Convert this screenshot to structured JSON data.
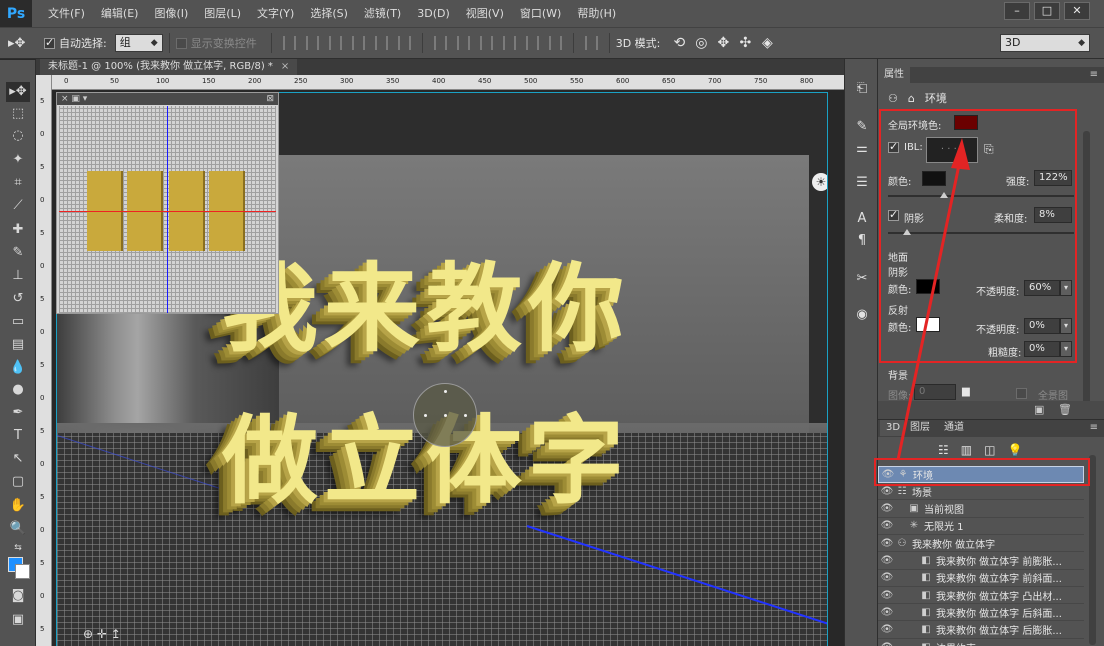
{
  "menubar": {
    "logo": "Ps",
    "items": [
      "文件(F)",
      "编辑(E)",
      "图像(I)",
      "图层(L)",
      "文字(Y)",
      "选择(S)",
      "滤镜(T)",
      "3D(D)",
      "视图(V)",
      "窗口(W)",
      "帮助(H)"
    ],
    "window_controls": [
      "–",
      "□",
      "✕"
    ]
  },
  "options": {
    "tool_icon": "move-icon",
    "auto_select_label": "自动选择:",
    "auto_select_value": "组",
    "show_transform_label": "显示变换控件",
    "mode3d_label": "3D 模式:",
    "workspace_value": "3D"
  },
  "document": {
    "tab_title": "未标题-1 @ 100% (我来教你 做立体字, RGB/8) *",
    "tab_close": "×",
    "ruler_h_ticks": [
      "0",
      "50",
      "100",
      "150",
      "200",
      "250",
      "300",
      "350",
      "400",
      "450",
      "500",
      "550",
      "600",
      "650",
      "700",
      "750",
      "800"
    ],
    "ruler_v_ticks": [
      "5",
      "0",
      "5",
      "0",
      "5",
      "0",
      "5",
      "0",
      "5",
      "0",
      "5",
      "0",
      "5",
      "0",
      "5",
      "0",
      "5"
    ],
    "text_line1": "我来教你",
    "text_line2": "做立体字",
    "thumb_close": "×"
  },
  "properties": {
    "tab": "属性",
    "panel_menu": "≡",
    "title": "环境",
    "global_env_color_label": "全局环境色:",
    "global_env_color": "#6b0000",
    "ibl_label": "IBL:",
    "color_label": "颜色:",
    "intensity_label": "强度:",
    "intensity_value": "122%",
    "intensity_level": 0.3,
    "shadow_label": "阴影",
    "softness_label": "柔和度:",
    "softness_value": "8%",
    "softness_level": 0.1,
    "ground_label": "地面",
    "ground_shadow_label": "阴影",
    "ground_color_label": "颜色:",
    "ground_shadow_color": "#000000",
    "opacity_label": "不透明度:",
    "shadow_opacity_value": "60%",
    "reflection_label": "反射",
    "reflection_color_label": "颜色:",
    "reflection_color": "#ffffff",
    "reflection_opacity_value": "0%",
    "roughness_label": "粗糙度:",
    "roughness_value": "0%",
    "background_label": "背景",
    "image_label": "图像:",
    "image_value": "0",
    "panorama_label": "全景图"
  },
  "layers_panel": {
    "tabs": [
      "3D",
      "图层",
      "通道"
    ],
    "panel_menu": "≡",
    "rows": [
      {
        "name": "环境",
        "icon": "environment-icon",
        "indent": 0,
        "selected": true
      },
      {
        "name": "场景",
        "icon": "scene-icon",
        "indent": 0,
        "selected": false
      },
      {
        "name": "当前视图",
        "icon": "camera-icon",
        "indent": 1,
        "selected": false
      },
      {
        "name": "无限光 1",
        "icon": "light-icon",
        "indent": 1,
        "selected": false
      },
      {
        "name": "我来教你 做立体字",
        "icon": "mesh-icon",
        "indent": 0,
        "selected": false
      },
      {
        "name": "我来教你 做立体字 前膨胀...",
        "icon": "material-icon",
        "indent": 2,
        "selected": false
      },
      {
        "name": "我来教你 做立体字 前斜面...",
        "icon": "material-icon",
        "indent": 2,
        "selected": false
      },
      {
        "name": "我来教你 做立体字 凸出材...",
        "icon": "material-icon",
        "indent": 2,
        "selected": false
      },
      {
        "name": "我来教你 做立体字 后斜面...",
        "icon": "material-icon",
        "indent": 2,
        "selected": false
      },
      {
        "name": "我来教你 做立体字 后膨胀...",
        "icon": "material-icon",
        "indent": 2,
        "selected": false
      },
      {
        "name": "边界约束...",
        "icon": "material-icon",
        "indent": 2,
        "selected": false
      }
    ]
  },
  "colors": {
    "annotation_red": "#e32424",
    "foreground": "#1e90ff",
    "background": "#ffffff",
    "text_face": "#f2e88a"
  }
}
